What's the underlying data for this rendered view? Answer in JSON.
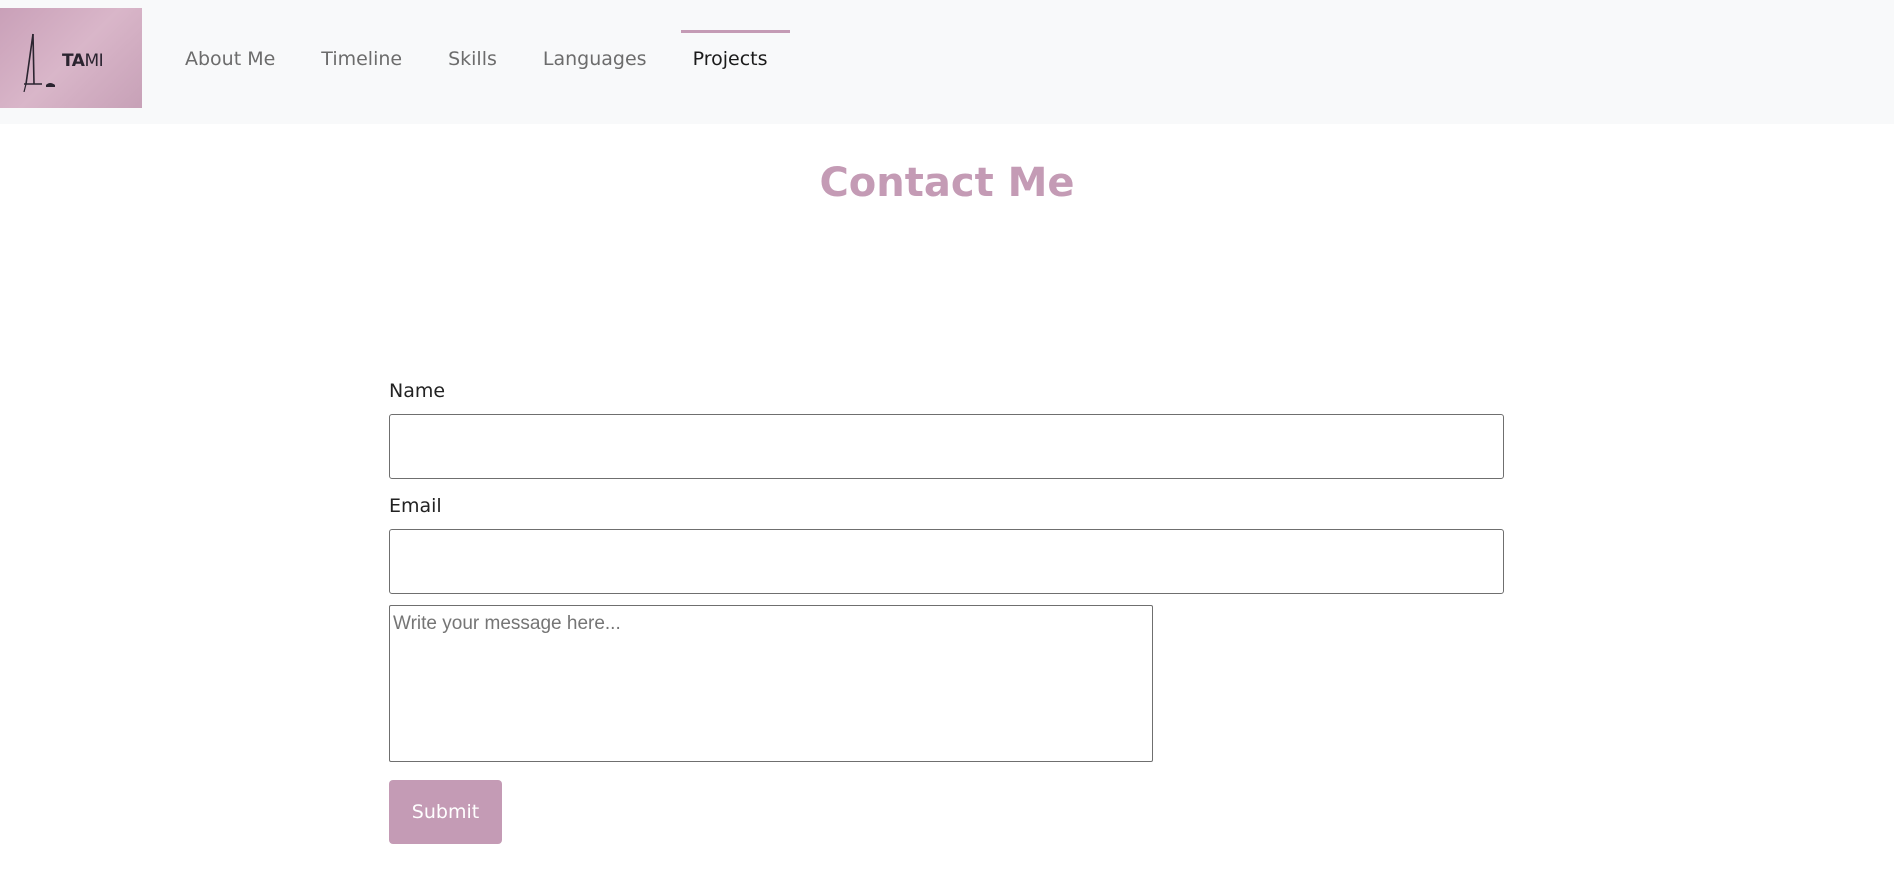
{
  "brand": {
    "logo_text_bold": "TA",
    "logo_text_light": "MI",
    "logo_icon": "easel-icon",
    "color": "#c9a0b8"
  },
  "nav": {
    "items": [
      {
        "label": "About Me",
        "active": false
      },
      {
        "label": "Timeline",
        "active": false
      },
      {
        "label": "Skills",
        "active": false
      },
      {
        "label": "Languages",
        "active": false
      },
      {
        "label": "Projects",
        "active": true
      }
    ],
    "active_indicator_color": "#c49bb5"
  },
  "main": {
    "title": "Contact Me",
    "title_color": "#c49bb5"
  },
  "form": {
    "name_label": "Name",
    "name_value": "",
    "email_label": "Email",
    "email_value": "",
    "message_placeholder": "Write your message here...",
    "message_value": "",
    "submit_label": "Submit",
    "submit_color": "#c49bb5"
  }
}
